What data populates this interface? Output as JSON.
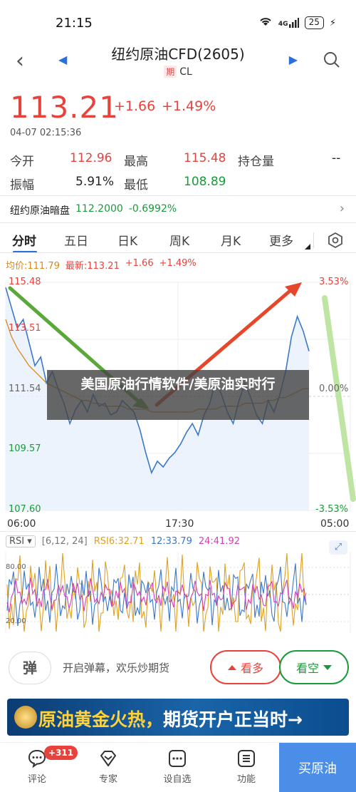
{
  "status_bar": {
    "time": "21:15",
    "signal": "4G",
    "battery": "25"
  },
  "header": {
    "title": "纽约原油CFD(2605)",
    "tag": "期",
    "code": "CL"
  },
  "quote": {
    "price": "113.21",
    "change": "+1.66",
    "change_pct": "+1.49%",
    "timestamp": "04-07 02:15:36"
  },
  "stats": {
    "open_label": "今开",
    "open": "112.96",
    "high_label": "最高",
    "high": "115.48",
    "oi_label": "持仓量",
    "oi": "--",
    "amp_label": "振幅",
    "amp": "5.91%",
    "low_label": "最低",
    "low": "108.89"
  },
  "dark_pool": {
    "label": "纽约原油暗盘",
    "price": "112.2000",
    "change": "-0.6992%"
  },
  "tabs": [
    "分时",
    "五日",
    "日K",
    "周K",
    "月K",
    "更多"
  ],
  "legend": {
    "avg": "均价:111.79",
    "last": "最新:113.21",
    "change": "+1.66",
    "change_pct": "+1.49%"
  },
  "y_axis_left": [
    "115.48",
    "113.51",
    "111.54",
    "109.57",
    "107.60"
  ],
  "y_axis_right": [
    "3.53%",
    "0.00%",
    "-3.53%"
  ],
  "time_axis": [
    "06:00",
    "17:30",
    "05:00"
  ],
  "rsi": {
    "selector": "RSI",
    "params": "[6,12, 24]",
    "rsi6": "RSI6:32.71",
    "rsi12": "12:33.79",
    "rsi24": "24:41.92",
    "levels": [
      "80.00",
      "20.00"
    ]
  },
  "comment": {
    "danmu_icon": "弹",
    "placeholder": "开启弹幕，欢乐炒期货"
  },
  "buttons": {
    "bull": "看多",
    "bear": "看空"
  },
  "banner": {
    "text_a": "原油黄金火热，",
    "text_b": "期货开户正当时→"
  },
  "overlay_caption": "美国原油行情软件/美原油实时行",
  "bottom_nav": {
    "comment": "评论",
    "comment_badge": "+311",
    "expert": "专家",
    "watchlist": "设自选",
    "features": "功能",
    "buy": "买原油"
  },
  "colors": {
    "up": "#e8423c",
    "down": "#1a9a3a",
    "accent": "#2a6fdb",
    "avg_line": "#d68a1a"
  },
  "chart_data": {
    "type": "line",
    "x_start": "06:00",
    "x_mid": "17:30",
    "x_end": "05:00",
    "ylim": [
      107.6,
      115.48
    ],
    "y_ticks": [
      115.48,
      113.51,
      111.54,
      109.57,
      107.6
    ],
    "series": [
      {
        "name": "price",
        "values": [
          115.3,
          114.6,
          113.9,
          114.2,
          113.4,
          112.6,
          112.9,
          112.0,
          112.4,
          111.8,
          111.3,
          110.6,
          111.1,
          111.4,
          111.0,
          111.6,
          111.2,
          111.3,
          110.9,
          111.0,
          111.4,
          111.2,
          111.0,
          110.4,
          109.6,
          108.9,
          109.3,
          109.1,
          109.4,
          109.6,
          109.9,
          110.3,
          110.6,
          110.2,
          110.9,
          111.3,
          112.1,
          111.6,
          111.0,
          110.6,
          111.4,
          112.0,
          111.5,
          110.9,
          110.6,
          111.4,
          111.0,
          111.6,
          112.4,
          113.6,
          114.3,
          113.8,
          113.1
        ],
        "color": "#3a78c8"
      },
      {
        "name": "avg",
        "values": [
          114.2,
          113.6,
          113.2,
          112.9,
          112.6,
          112.4,
          112.2,
          112.0,
          111.9,
          111.8,
          111.7,
          111.6,
          111.5,
          111.4,
          111.4,
          111.3,
          111.3,
          111.2,
          111.2,
          111.2,
          111.2,
          111.1,
          111.1,
          111.1,
          111.1,
          111.0,
          111.0,
          111.0,
          111.0,
          111.0,
          111.0,
          111.0,
          111.0,
          111.1,
          111.1,
          111.1,
          111.1,
          111.2,
          111.2,
          111.2,
          111.2,
          111.3,
          111.3,
          111.3,
          111.3,
          111.4,
          111.4,
          111.5,
          111.5,
          111.6,
          111.7,
          111.8,
          111.8
        ],
        "color": "#d68a1a"
      }
    ]
  }
}
